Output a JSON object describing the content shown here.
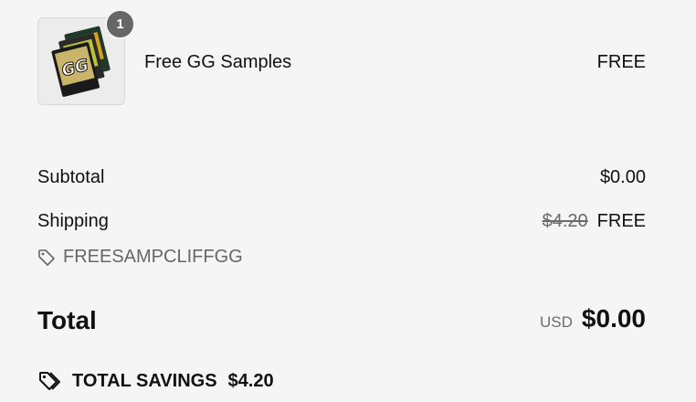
{
  "item": {
    "quantity": "1",
    "name": "Free GG Samples",
    "price": "FREE",
    "thumbnail_text": "GG"
  },
  "summary": {
    "subtotal_label": "Subtotal",
    "subtotal_value": "$0.00",
    "shipping_label": "Shipping",
    "shipping_original": "$4.20",
    "shipping_value": "FREE",
    "discount_code": "FREESAMPCLIFFGG"
  },
  "total": {
    "label": "Total",
    "currency": "USD",
    "amount": "$0.00"
  },
  "savings": {
    "label": "TOTAL SAVINGS",
    "amount": "$4.20"
  },
  "colors": {
    "background": "#f5f5f5",
    "muted_text": "#6b6b6b",
    "badge": "#666666"
  }
}
